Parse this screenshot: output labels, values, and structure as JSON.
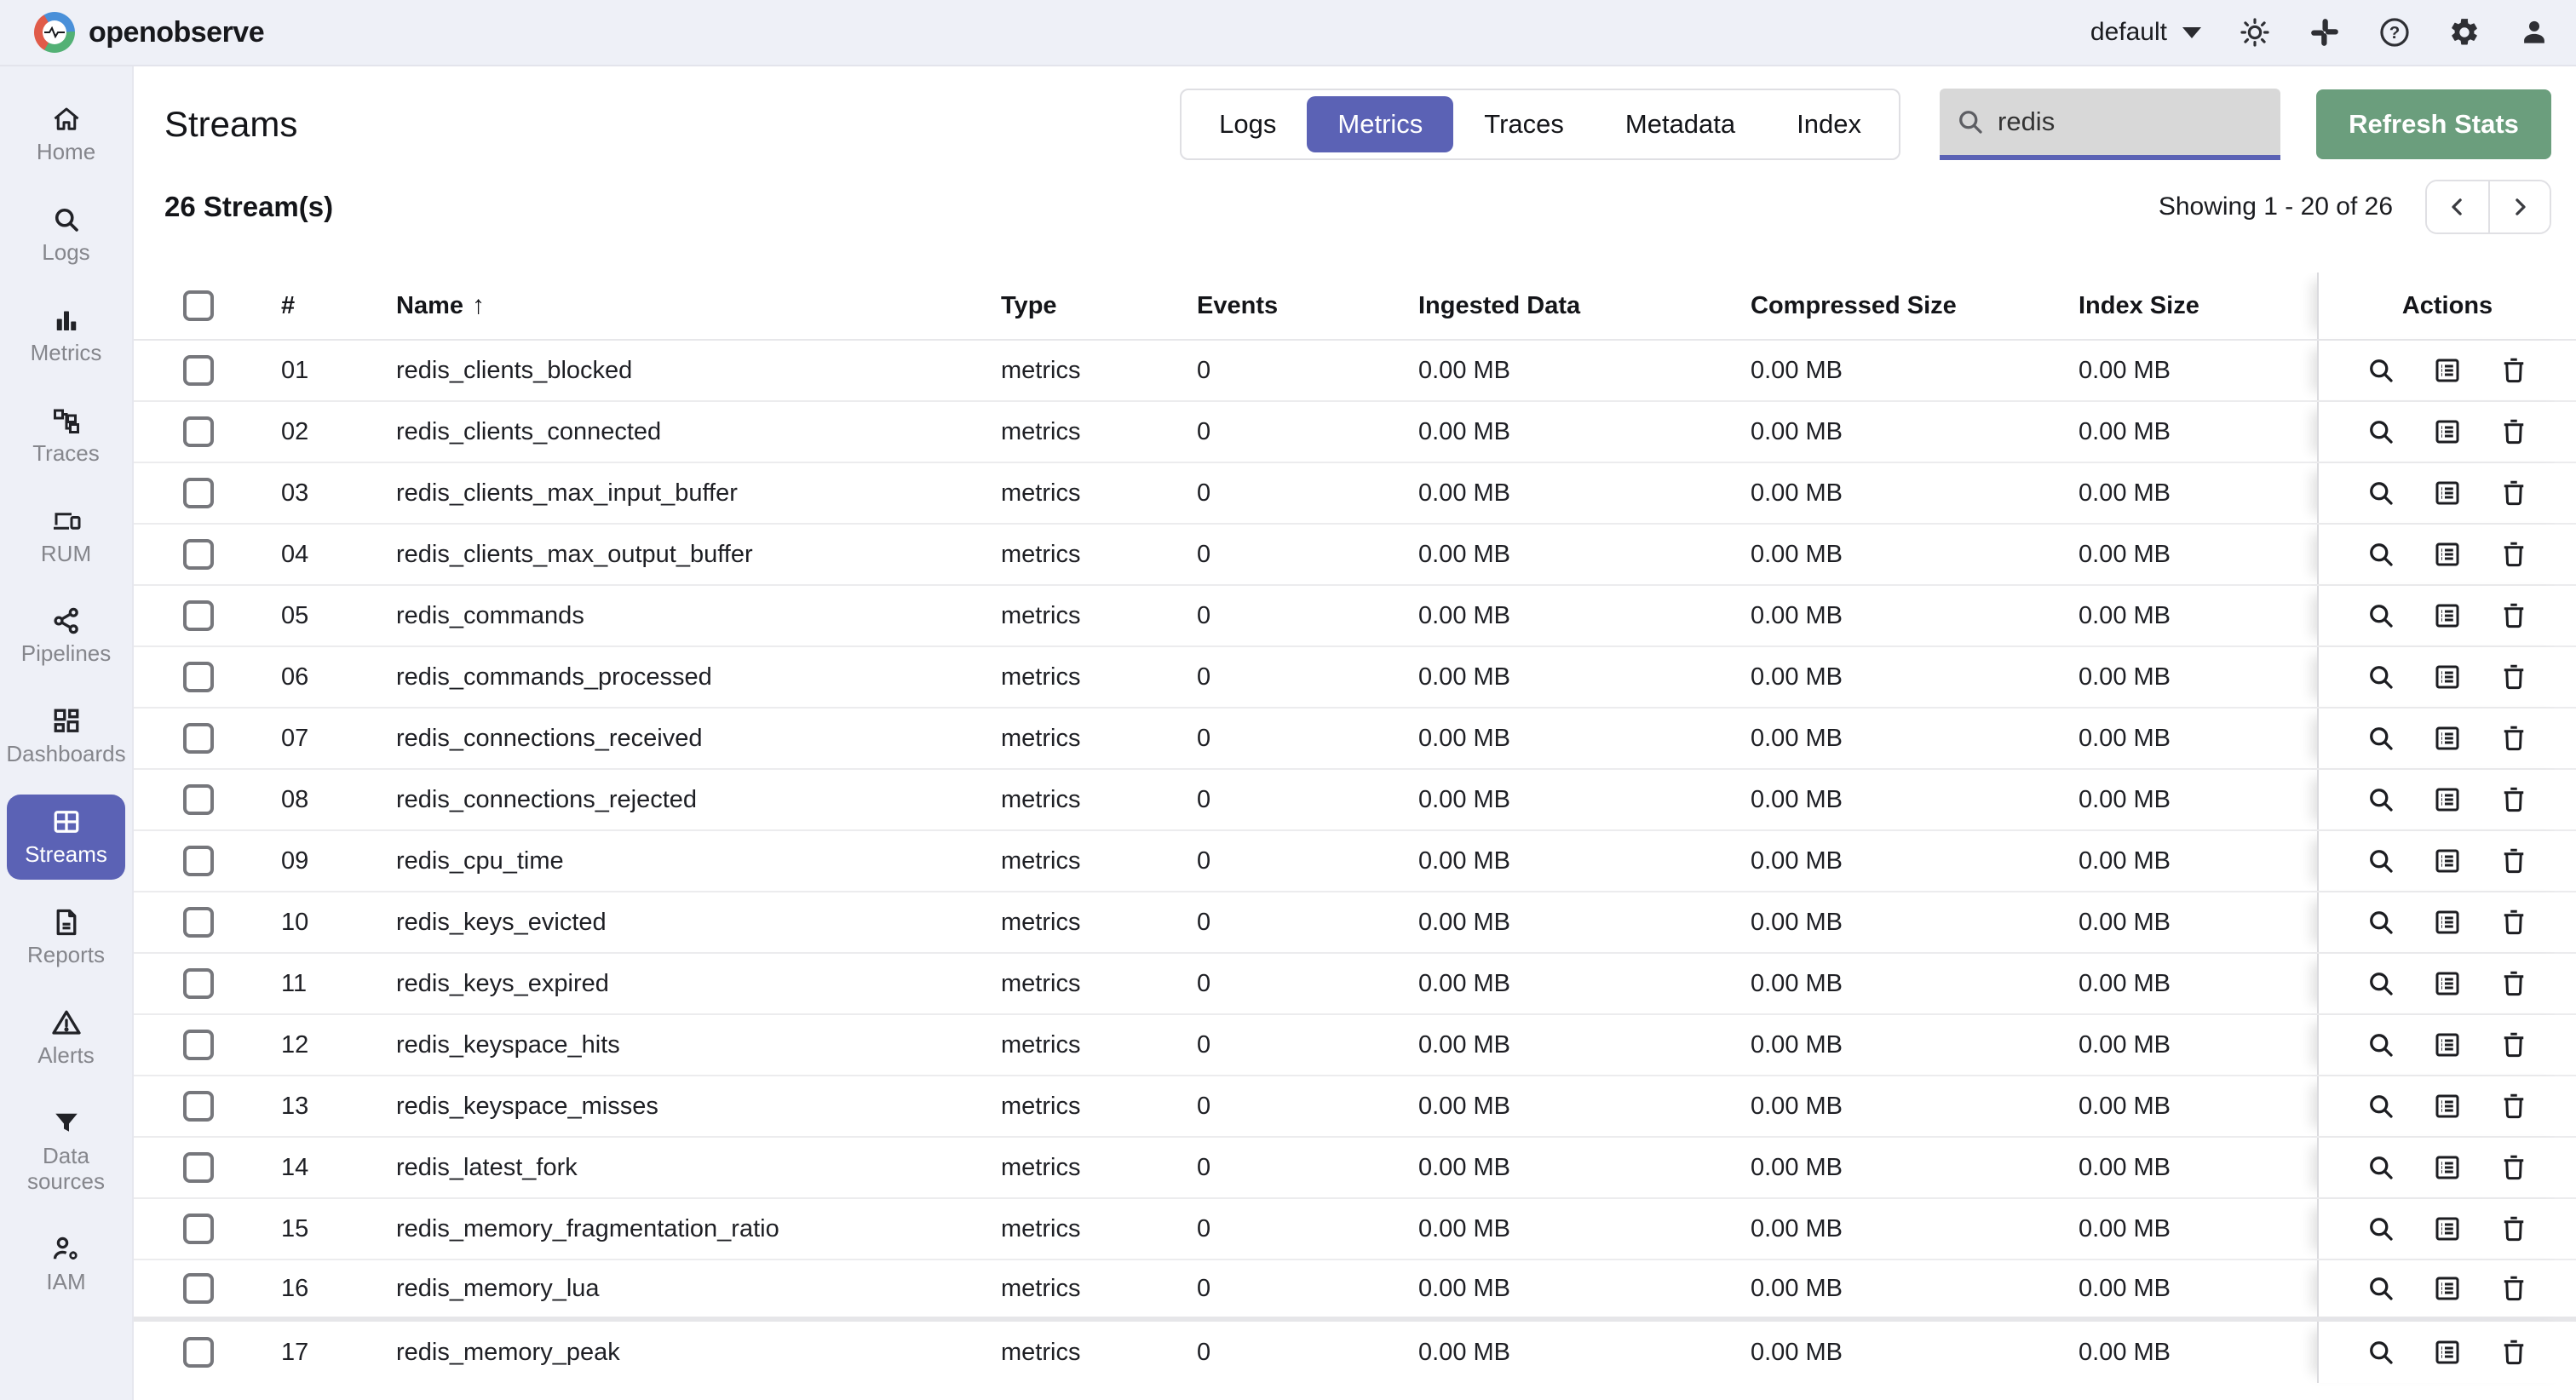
{
  "header": {
    "brand": "openobserve",
    "org_selector": "default",
    "icons": [
      "theme-light",
      "slack",
      "help",
      "settings",
      "account"
    ]
  },
  "sidebar": {
    "active_item": "Streams",
    "items": [
      {
        "label": "Home",
        "icon": "home"
      },
      {
        "label": "Logs",
        "icon": "search"
      },
      {
        "label": "Metrics",
        "icon": "bar-chart"
      },
      {
        "label": "Traces",
        "icon": "schema"
      },
      {
        "label": "RUM",
        "icon": "devices"
      },
      {
        "label": "Pipelines",
        "icon": "share-nodes"
      },
      {
        "label": "Dashboards",
        "icon": "dashboard-grid"
      },
      {
        "label": "Streams",
        "icon": "window-grid"
      },
      {
        "label": "Reports",
        "icon": "document"
      },
      {
        "label": "Alerts",
        "icon": "warning-triangle"
      },
      {
        "label": "Data sources",
        "icon": "filter-funnel"
      },
      {
        "label": "IAM",
        "icon": "user-gear"
      }
    ]
  },
  "page": {
    "title": "Streams",
    "tabs": [
      "Logs",
      "Metrics",
      "Traces",
      "Metadata",
      "Index"
    ],
    "selected_tab": "Metrics",
    "search": {
      "value": "redis",
      "icon": "search"
    },
    "refresh_label": "Refresh Stats",
    "count_label": "26 Stream(s)",
    "showing_label": "Showing 1 - 20 of 26",
    "pagination_icons": [
      "chevron-left",
      "chevron-right"
    ]
  },
  "table": {
    "headers": [
      "#",
      "Name",
      "Type",
      "Events",
      "Ingested Data",
      "Compressed Size",
      "Index Size",
      "Actions"
    ],
    "sort": {
      "column": "Name",
      "direction": "asc",
      "arrow": "↑"
    },
    "action_icons": [
      "explore-search",
      "stream-details-list",
      "delete-trash"
    ],
    "rows": [
      [
        "01",
        "redis_clients_blocked",
        "metrics",
        "0",
        "0.00 MB",
        "0.00 MB",
        "0.00 MB"
      ],
      [
        "02",
        "redis_clients_connected",
        "metrics",
        "0",
        "0.00 MB",
        "0.00 MB",
        "0.00 MB"
      ],
      [
        "03",
        "redis_clients_max_input_buffer",
        "metrics",
        "0",
        "0.00 MB",
        "0.00 MB",
        "0.00 MB"
      ],
      [
        "04",
        "redis_clients_max_output_buffer",
        "metrics",
        "0",
        "0.00 MB",
        "0.00 MB",
        "0.00 MB"
      ],
      [
        "05",
        "redis_commands",
        "metrics",
        "0",
        "0.00 MB",
        "0.00 MB",
        "0.00 MB"
      ],
      [
        "06",
        "redis_commands_processed",
        "metrics",
        "0",
        "0.00 MB",
        "0.00 MB",
        "0.00 MB"
      ],
      [
        "07",
        "redis_connections_received",
        "metrics",
        "0",
        "0.00 MB",
        "0.00 MB",
        "0.00 MB"
      ],
      [
        "08",
        "redis_connections_rejected",
        "metrics",
        "0",
        "0.00 MB",
        "0.00 MB",
        "0.00 MB"
      ],
      [
        "09",
        "redis_cpu_time",
        "metrics",
        "0",
        "0.00 MB",
        "0.00 MB",
        "0.00 MB"
      ],
      [
        "10",
        "redis_keys_evicted",
        "metrics",
        "0",
        "0.00 MB",
        "0.00 MB",
        "0.00 MB"
      ],
      [
        "11",
        "redis_keys_expired",
        "metrics",
        "0",
        "0.00 MB",
        "0.00 MB",
        "0.00 MB"
      ],
      [
        "12",
        "redis_keyspace_hits",
        "metrics",
        "0",
        "0.00 MB",
        "0.00 MB",
        "0.00 MB"
      ],
      [
        "13",
        "redis_keyspace_misses",
        "metrics",
        "0",
        "0.00 MB",
        "0.00 MB",
        "0.00 MB"
      ],
      [
        "14",
        "redis_latest_fork",
        "metrics",
        "0",
        "0.00 MB",
        "0.00 MB",
        "0.00 MB"
      ],
      [
        "15",
        "redis_memory_fragmentation_ratio",
        "metrics",
        "0",
        "0.00 MB",
        "0.00 MB",
        "0.00 MB"
      ],
      [
        "16",
        "redis_memory_lua",
        "metrics",
        "0",
        "0.00 MB",
        "0.00 MB",
        "0.00 MB"
      ],
      [
        "17",
        "redis_memory_peak",
        "metrics",
        "0",
        "0.00 MB",
        "0.00 MB",
        "0.00 MB"
      ]
    ]
  },
  "colors": {
    "accent_purple": "#5b62b5",
    "button_green": "#6b9e7d",
    "panel_bg": "#eef0f7",
    "search_bg": "#d8d8d8"
  }
}
